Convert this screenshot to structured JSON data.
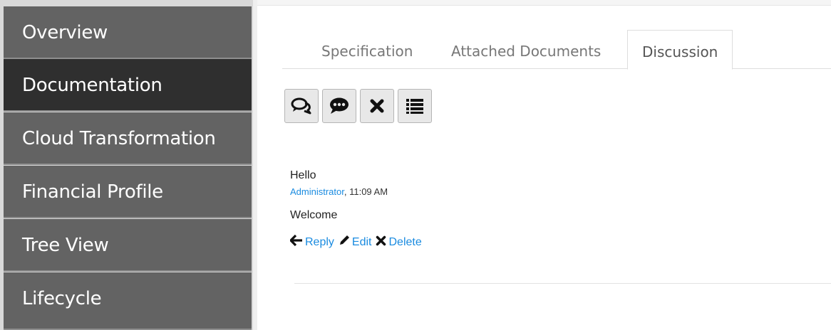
{
  "sidebar": {
    "items": [
      {
        "label": "Overview",
        "active": false
      },
      {
        "label": "Documentation",
        "active": true
      },
      {
        "label": "Cloud Transformation",
        "active": false
      },
      {
        "label": "Financial Profile",
        "active": false
      },
      {
        "label": "Tree View",
        "active": false
      },
      {
        "label": "Lifecycle",
        "active": false
      }
    ]
  },
  "tabs": [
    {
      "label": "Specification",
      "active": false
    },
    {
      "label": "Attached Documents",
      "active": false
    },
    {
      "label": "Discussion",
      "active": true
    }
  ],
  "toolbar": {
    "buttons": [
      {
        "icon": "comments-icon"
      },
      {
        "icon": "comment-dots-icon"
      },
      {
        "icon": "close-icon"
      },
      {
        "icon": "list-icon"
      }
    ]
  },
  "comment": {
    "title": "Hello",
    "author": "Administrator",
    "time": ", 11:09 AM",
    "body": "Welcome",
    "actions": {
      "reply": "Reply",
      "edit": "Edit",
      "delete": "Delete"
    }
  },
  "colors": {
    "sidebar_bg": "#636363",
    "sidebar_active_bg": "#2f2f2f",
    "link": "#1a8be0"
  }
}
